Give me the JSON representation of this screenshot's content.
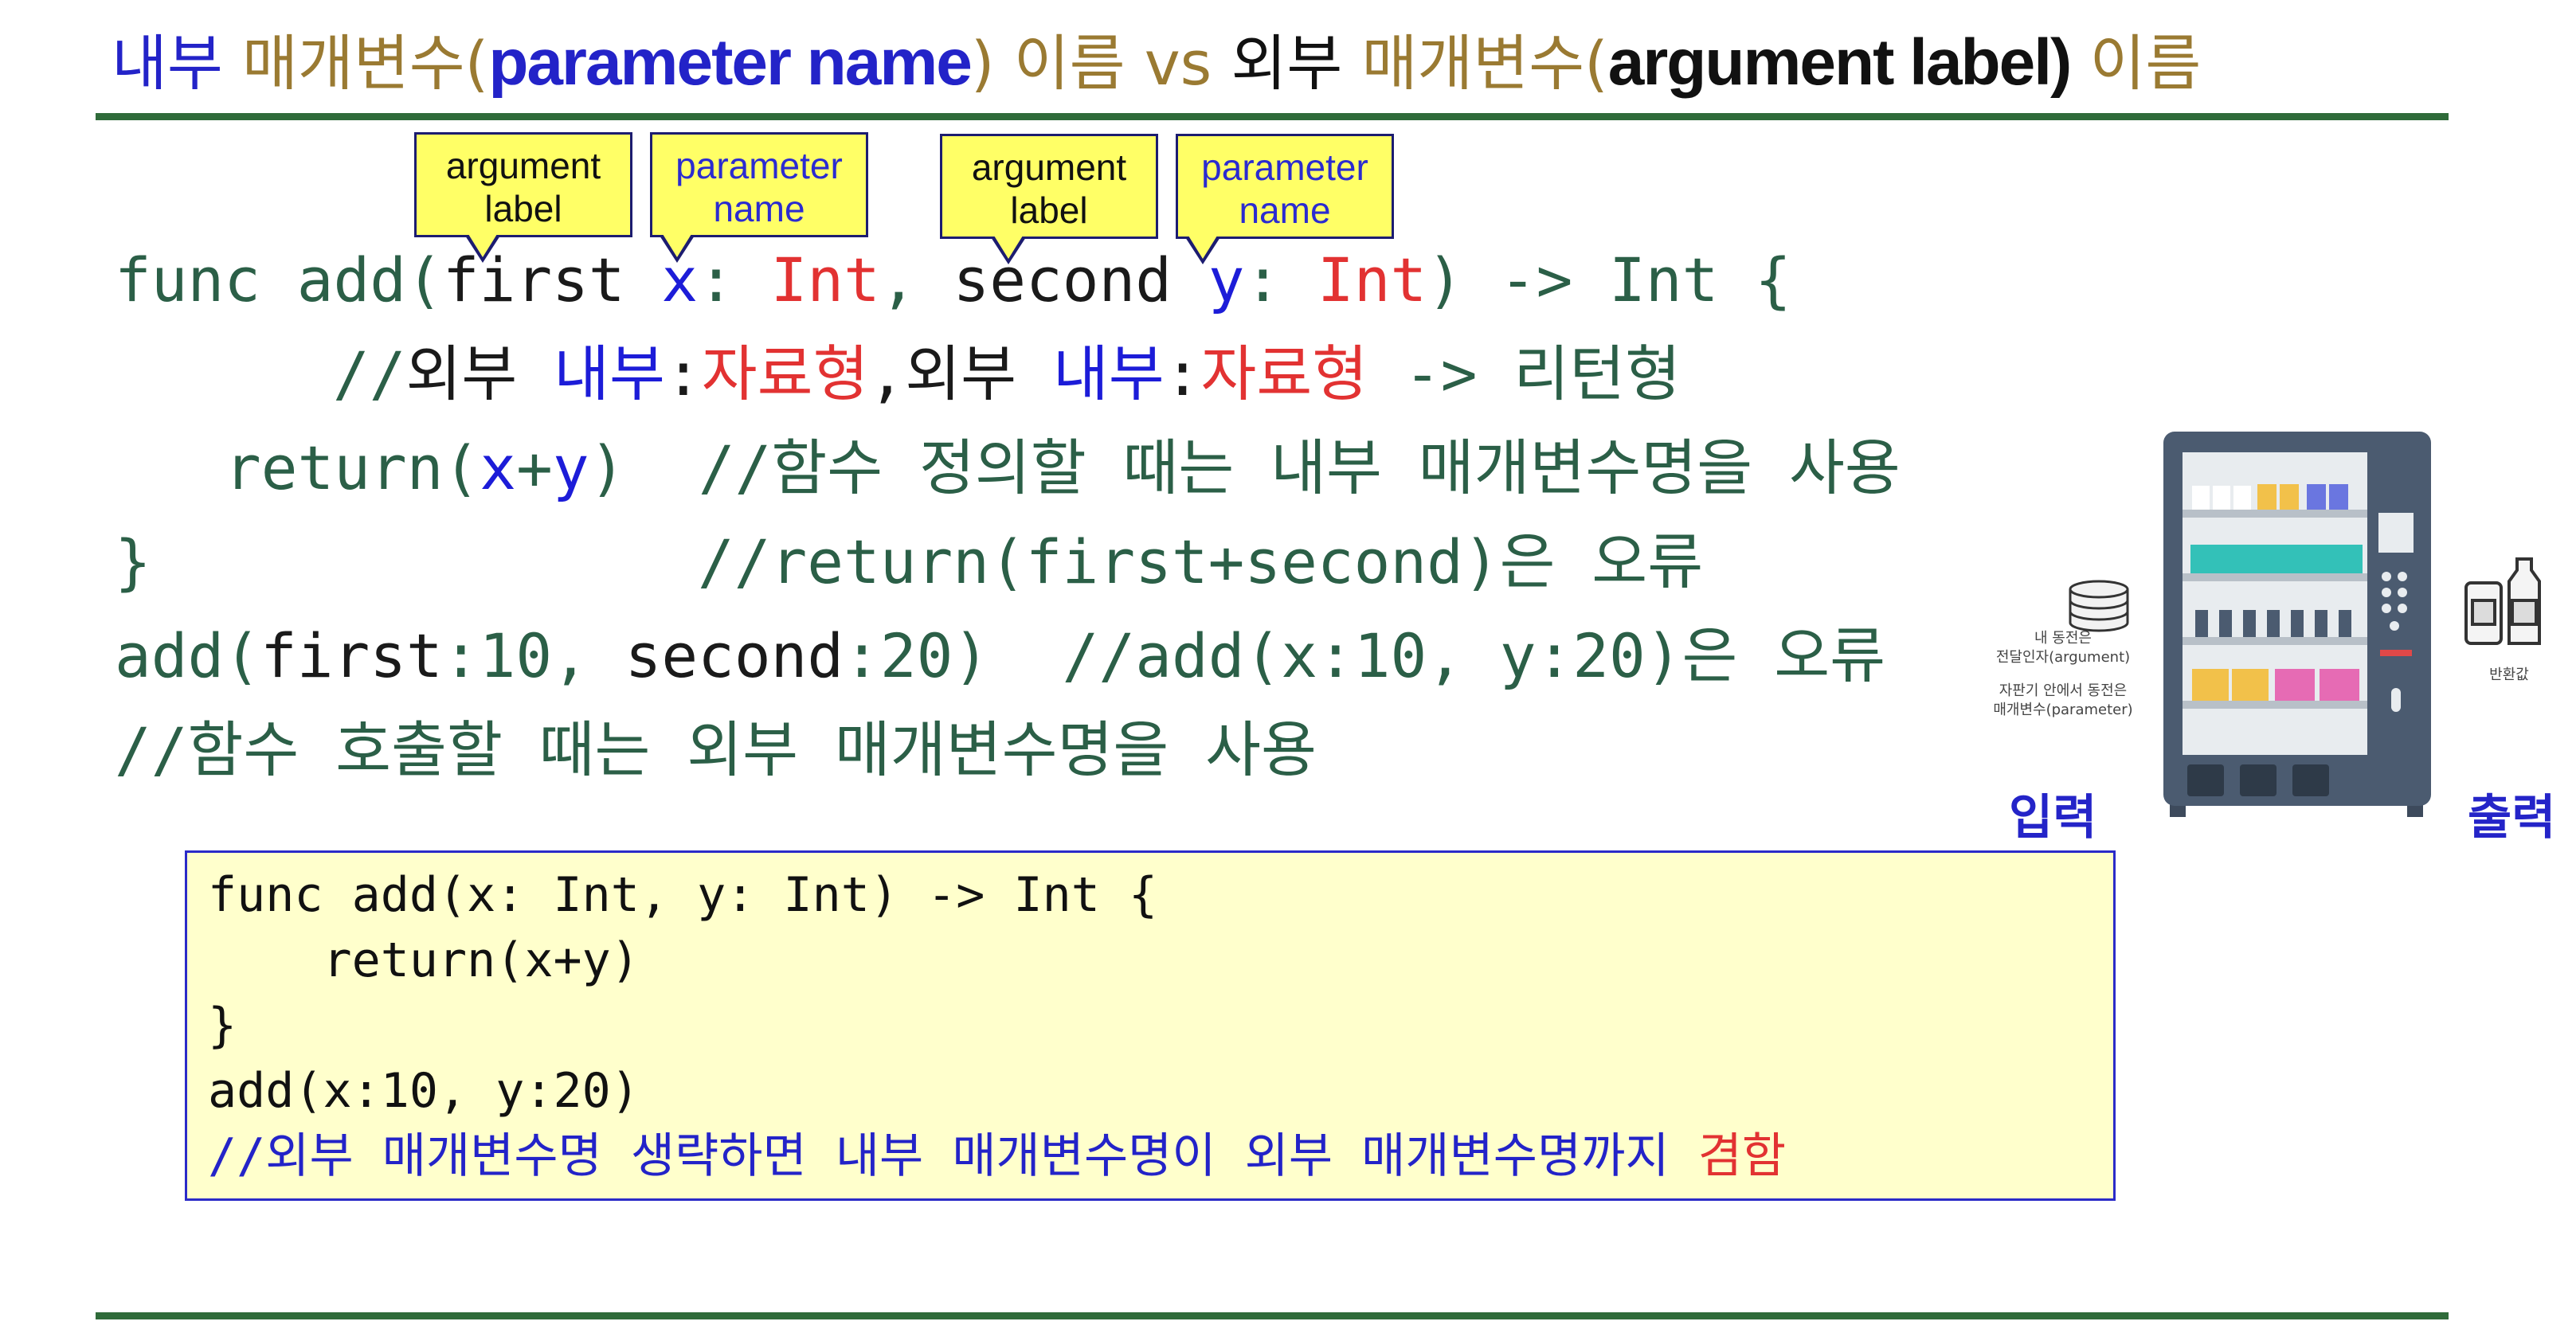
{
  "title": {
    "part1": "내부",
    "part2": " 매개변수(",
    "part3": "parameter name",
    "part4": ") 이름 vs ",
    "part5": "외부",
    "part6": " 매개변수(",
    "part7": "argument label)",
    "part8": " 이름"
  },
  "callouts": [
    {
      "line1": "argument",
      "line2": "label"
    },
    {
      "line1": "parameter",
      "line2": "name"
    },
    {
      "line1": "argument",
      "line2": "label"
    },
    {
      "line1": "parameter",
      "line2": "name"
    }
  ],
  "code": {
    "l1": {
      "a": "func add(",
      "b": "first ",
      "c": "x",
      "d": ": ",
      "e": "Int",
      "f": ", ",
      "g": "second ",
      "h": "y",
      "i": ": ",
      "j": "Int",
      "k": ") -> Int {"
    },
    "l2": {
      "a": "//",
      "b": "외부 ",
      "c": "내부",
      "d": ":",
      "e": "자료형",
      "f": ",외부 ",
      "g": "내부",
      "h": ":",
      "i": "자료형",
      "j": " -> 리턴형"
    },
    "l3": {
      "a": "return(",
      "b": "x",
      "c": "+",
      "d": "y",
      "e": ")  //함수 정의할 때는 내부 매개변수명을 사용"
    },
    "l4": {
      "a": "}",
      "b": "//return(first+second)은 오류"
    },
    "l5": {
      "a": "add(",
      "b": "first",
      "c": ":10, ",
      "d": "second",
      "e": ":20)  //add(x:10, y:20)은 오류"
    },
    "l6": {
      "a": "//함수 호출할 때는 외부 매개변수명을 사용"
    }
  },
  "box": {
    "l1": "func add(x: Int, y: Int) -> Int {",
    "l2": "    return(x+y)",
    "l3": "}",
    "l4": "add(x:10, y:20)",
    "l5a": "//외부 매개변수명 생략하면 내부 매개변수명이 외부 매개변수명까지 ",
    "l5b": "겸함"
  },
  "figure": {
    "coin_caption1": "내 동전은",
    "coin_caption2": "전달인자(argument)",
    "slot_caption1": "자판기 안에서 동전은",
    "slot_caption2": "매개변수(parameter)",
    "return_caption": "반환값",
    "input_label": "입력",
    "output_label": "출력"
  },
  "icons": [
    "coin-stack-icon",
    "vending-machine-icon",
    "drink-bottles-icon"
  ],
  "colors": {
    "blue": "#2323c8",
    "gold": "#9a7a32",
    "red": "#e23232",
    "green": "#2b5f47",
    "rule": "#2f6b3a",
    "callout": "#ffff66"
  }
}
